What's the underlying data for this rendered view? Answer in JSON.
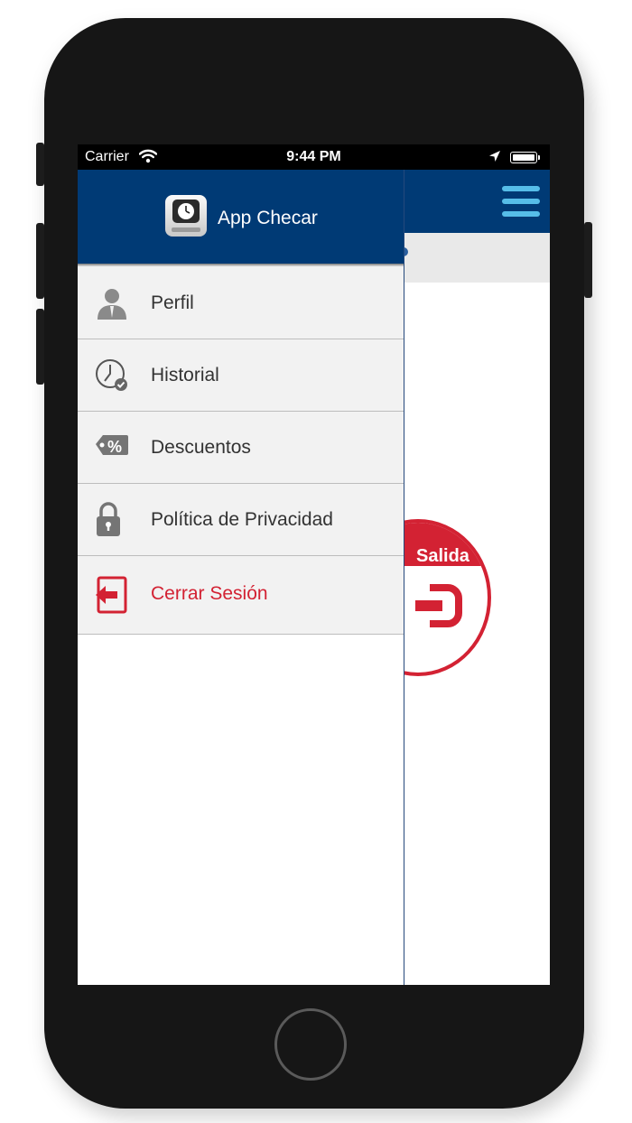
{
  "status_bar": {
    "carrier": "Carrier",
    "time": "9:44 PM"
  },
  "drawer": {
    "app_title": "App Checar",
    "items": [
      {
        "label": "Perfil",
        "icon": "user-icon"
      },
      {
        "label": "Historial",
        "icon": "clock-check-icon"
      },
      {
        "label": "Descuentos",
        "icon": "discount-tag-icon"
      },
      {
        "label": "Política de Privacidad",
        "icon": "lock-icon"
      },
      {
        "label": "Cerrar Sesión",
        "icon": "logout-icon"
      }
    ]
  },
  "main": {
    "salida_label": "Salida"
  },
  "colors": {
    "header_blue": "#003a75",
    "hamburger": "#56bde8",
    "accent_red": "#d32233",
    "drawer_bg": "#f2f2f2"
  }
}
